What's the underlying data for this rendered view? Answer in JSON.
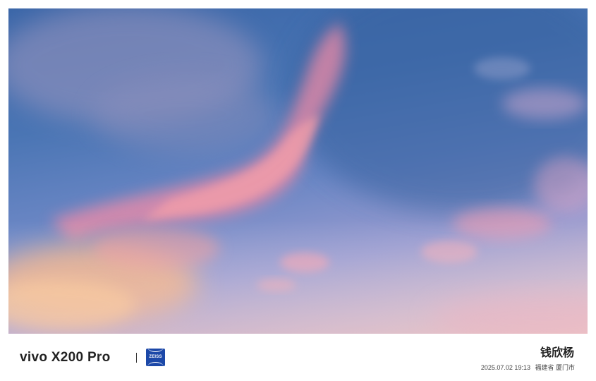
{
  "photo": {
    "subject": "sky-clouds"
  },
  "footer": {
    "brand": "vivo X200 Pro",
    "lens_logo_text": "ZEISS",
    "author": "钱欣杨",
    "datetime": "2025.07.02 19:13",
    "location": "福建省 厦门市"
  },
  "colors": {
    "zeiss_blue": "#1c48a8",
    "sky_top": "#3a66a8",
    "cloud_pink": "#f08aa0",
    "cloud_orange": "#f6b27c",
    "text": "#222222"
  }
}
